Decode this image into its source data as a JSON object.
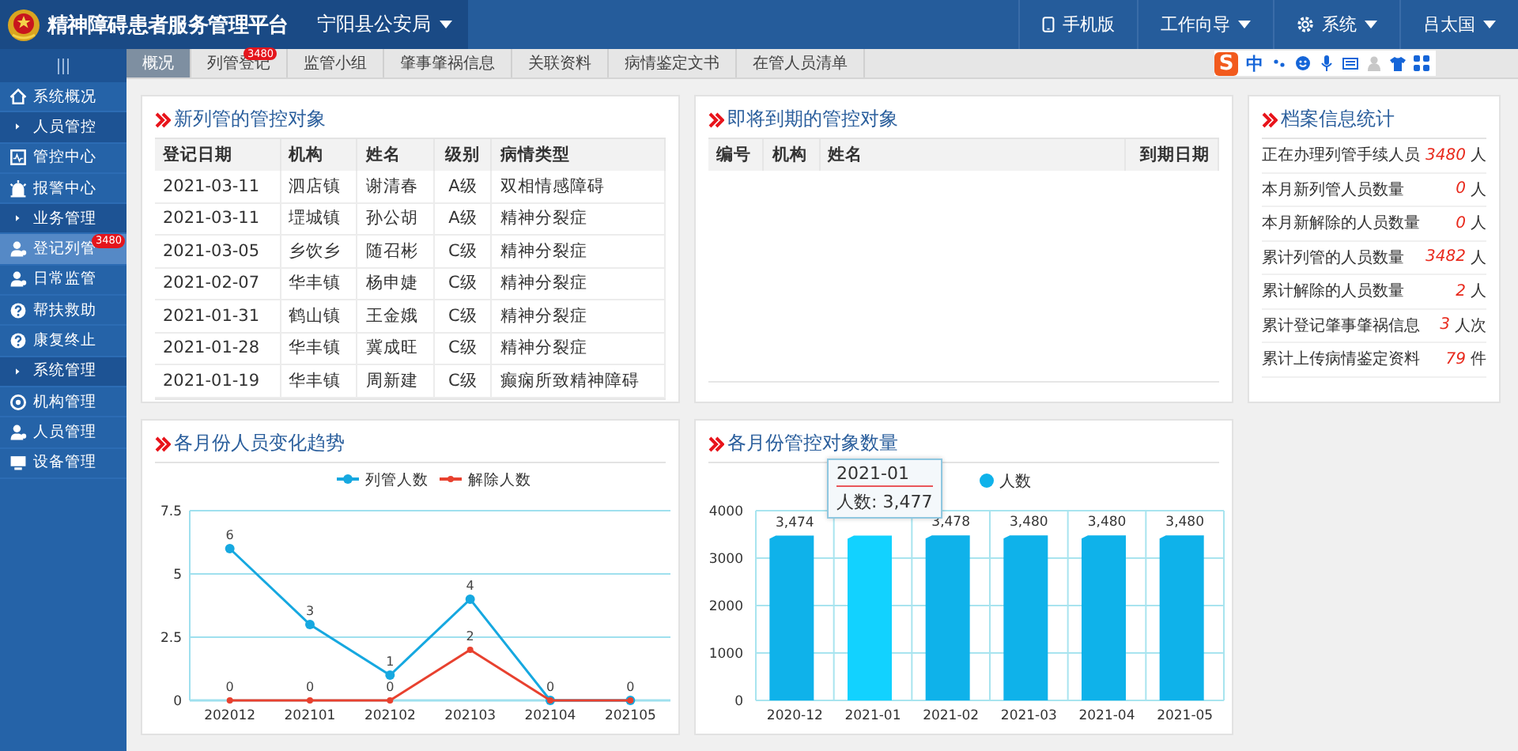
{
  "header": {
    "title": "精神障碍患者服务管理平台",
    "unit": "宁阳县公安局",
    "menu": [
      {
        "label": "手机版",
        "kind": "phone"
      },
      {
        "label": "工作向导",
        "kind": "dropdown"
      },
      {
        "label": "系统",
        "kind": "settings"
      },
      {
        "label": "吕太国",
        "kind": "dropdown"
      }
    ]
  },
  "ime_toolbar": {
    "logo_letter": "S",
    "mode": "中"
  },
  "sidebar": {
    "items": [
      {
        "label": "系统概况",
        "kind": "link",
        "selected": false
      },
      {
        "label": "人员管控",
        "kind": "section"
      },
      {
        "label": "管控中心",
        "kind": "link",
        "selected": false
      },
      {
        "label": "报警中心",
        "kind": "link",
        "selected": false
      },
      {
        "label": "业务管理",
        "kind": "section"
      },
      {
        "label": "登记列管",
        "kind": "link",
        "selected": true,
        "badge": "3480"
      },
      {
        "label": "日常监管",
        "kind": "link",
        "selected": false
      },
      {
        "label": "帮扶救助",
        "kind": "link",
        "selected": false
      },
      {
        "label": "康复终止",
        "kind": "link",
        "selected": false
      },
      {
        "label": "系统管理",
        "kind": "section"
      },
      {
        "label": "机构管理",
        "kind": "link",
        "selected": false
      },
      {
        "label": "人员管理",
        "kind": "link",
        "selected": false
      },
      {
        "label": "设备管理",
        "kind": "link",
        "selected": false
      }
    ]
  },
  "tabs": [
    {
      "label": "概况",
      "selected": true
    },
    {
      "label": "列管登记",
      "selected": false,
      "badge": "3480"
    },
    {
      "label": "监管小组",
      "selected": false
    },
    {
      "label": "肇事肇祸信息",
      "selected": false
    },
    {
      "label": "关联资料",
      "selected": false
    },
    {
      "label": "病情鉴定文书",
      "selected": false
    },
    {
      "label": "在管人员清单",
      "selected": false
    }
  ],
  "new_objects": {
    "title": "新列管的管控对象",
    "columns": [
      "登记日期",
      "机构",
      "姓名",
      "级别",
      "病情类型"
    ],
    "rows": [
      [
        "2021-03-11",
        "泗店镇",
        "谢清春",
        "A级",
        "双相情感障碍"
      ],
      [
        "2021-03-11",
        "堽城镇",
        "孙公胡",
        "A级",
        "精神分裂症"
      ],
      [
        "2021-03-05",
        "乡饮乡",
        "随召彬",
        "C级",
        "精神分裂症"
      ],
      [
        "2021-02-07",
        "华丰镇",
        "杨申婕",
        "C级",
        "精神分裂症"
      ],
      [
        "2021-01-31",
        "鹤山镇",
        "王金娥",
        "C级",
        "精神分裂症"
      ],
      [
        "2021-01-28",
        "华丰镇",
        "冀成旺",
        "C级",
        "精神分裂症"
      ],
      [
        "2021-01-19",
        "华丰镇",
        "周新建",
        "C级",
        "癫痫所致精神障碍"
      ]
    ]
  },
  "expiring_objects": {
    "title": "即将到期的管控对象",
    "columns": [
      "编号",
      "机构",
      "姓名",
      "到期日期"
    ]
  },
  "archive_stats": {
    "title": "档案信息统计",
    "items": [
      {
        "label": "正在办理列管手续人员",
        "value": "3480",
        "unit": "人"
      },
      {
        "label": "本月新列管人员数量",
        "value": "0",
        "unit": "人"
      },
      {
        "label": "本月新解除的人员数量",
        "value": "0",
        "unit": "人"
      },
      {
        "label": "累计列管的人员数量",
        "value": "3482",
        "unit": "人"
      },
      {
        "label": "累计解除的人员数量",
        "value": "2",
        "unit": "人"
      },
      {
        "label": "累计登记肇事肇祸信息",
        "value": "3",
        "unit": "人次"
      },
      {
        "label": "累计上传病情鉴定资料",
        "value": "79",
        "unit": "件"
      }
    ]
  },
  "monthly_trend": {
    "title": "各月份人员变化趋势",
    "chart_data": {
      "type": "line",
      "categories": [
        "202012",
        "202101",
        "202102",
        "202103",
        "202104",
        "202105"
      ],
      "series": [
        {
          "name": "列管人数",
          "color": "#16a8e0",
          "marker": "circle",
          "values": [
            6,
            3,
            1,
            4,
            0,
            0
          ],
          "value_labels": [
            "6",
            "3",
            "1",
            "4",
            "0",
            "0"
          ]
        },
        {
          "name": "解除人数",
          "color": "#e8412f",
          "marker": "circle",
          "values": [
            0,
            0,
            0,
            2,
            0,
            0
          ],
          "value_labels": [
            "0",
            "0",
            "0",
            "2",
            null,
            null
          ]
        }
      ],
      "ylim": [
        0,
        7.5
      ],
      "yticks": [
        0,
        2.5,
        5,
        7.5
      ],
      "legend": true,
      "grid": true
    }
  },
  "monthly_count": {
    "title": "各月份管控对象数量",
    "chart_data": {
      "type": "bar",
      "categories": [
        "2020-12",
        "2021-01",
        "2021-02",
        "2021-03",
        "2021-04",
        "2021-05"
      ],
      "series": [
        {
          "name": "人数",
          "color": "#0fb2ea",
          "values": [
            3474,
            3477,
            3478,
            3480,
            3480,
            3480
          ],
          "value_labels": [
            "3,474",
            null,
            "3,478",
            "3,480",
            "3,480",
            "3,480"
          ]
        }
      ],
      "ylim": [
        0,
        4000
      ],
      "yticks": [
        0,
        1000,
        2000,
        3000,
        4000
      ],
      "legend": true,
      "grid": true
    },
    "bars": [
      {
        "selected": false
      },
      {
        "selected": true
      },
      {
        "selected": false
      },
      {
        "selected": false
      },
      {
        "selected": false
      },
      {
        "selected": false
      }
    ],
    "tooltip": {
      "title": "2021-01",
      "text": "人数: 3,477"
    }
  }
}
